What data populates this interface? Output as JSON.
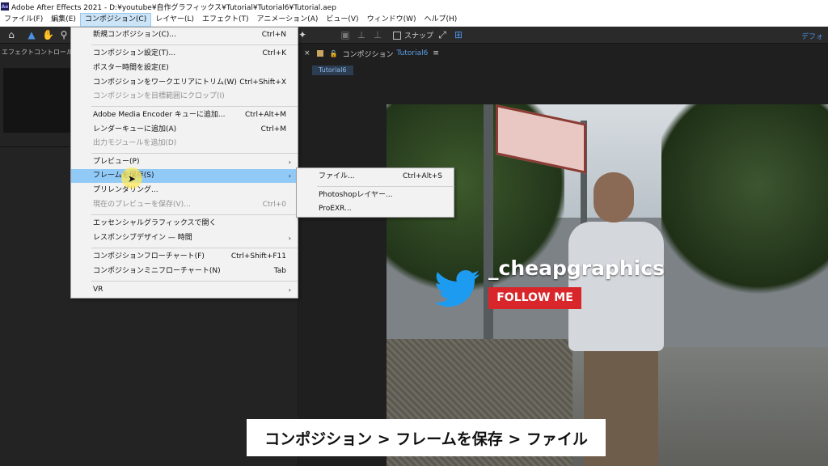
{
  "window": {
    "app_icon": "Ae",
    "title": "Adobe After Effects 2021 - D:¥youtube¥自作グラフィックス¥Tutorial¥Tutorial6¥Tutorial.aep"
  },
  "menubar": {
    "items": [
      "ファイル(F)",
      "編集(E)",
      "コンポジション(C)",
      "レイヤー(L)",
      "エフェクト(T)",
      "アニメーション(A)",
      "ビュー(V)",
      "ウィンドウ(W)",
      "ヘルプ(H)"
    ],
    "active_index": 2
  },
  "toolbar": {
    "snap_label": "スナップ",
    "workspace": "デフォ"
  },
  "left_panel": {
    "tab_label": "エフェクトコントロール s"
  },
  "comp_panel": {
    "tab_prefix": "コンポジション",
    "comp_name": "Tutorial6",
    "sub_tab": "Tutorial6"
  },
  "composition_menu": {
    "items": [
      {
        "label": "新規コンポジション(C)...",
        "shortcut": "Ctrl+N"
      },
      {
        "label": "コンポジション設定(T)...",
        "shortcut": "Ctrl+K"
      },
      {
        "label": "ポスター時間を設定(E)",
        "shortcut": ""
      },
      {
        "label": "コンポジションをワークエリアにトリム(W)",
        "shortcut": "Ctrl+Shift+X"
      },
      {
        "label": "コンポジションを目標範囲にクロップ(I)",
        "shortcut": "",
        "disabled": true
      },
      {
        "label": "Adobe Media Encoder キューに追加...",
        "shortcut": "Ctrl+Alt+M"
      },
      {
        "label": "レンダーキューに追加(A)",
        "shortcut": "Ctrl+M"
      },
      {
        "label": "出力モジュールを追加(D)",
        "shortcut": "",
        "disabled": true
      },
      {
        "label": "プレビュー(P)",
        "shortcut": "",
        "submenu": true
      },
      {
        "label": "フレームを保存(S)",
        "shortcut": "",
        "submenu": true,
        "highlighted": true
      },
      {
        "label": "プリレンダリング...",
        "shortcut": ""
      },
      {
        "label": "現在のプレビューを保存(V)...",
        "shortcut": "Ctrl+0",
        "disabled": true
      },
      {
        "label": "エッセンシャルグラフィックスで開く",
        "shortcut": ""
      },
      {
        "label": "レスポンシブデザイン — 時間",
        "shortcut": "",
        "submenu": true
      },
      {
        "label": "コンポジションフローチャート(F)",
        "shortcut": "Ctrl+Shift+F11"
      },
      {
        "label": "コンポジションミニフローチャート(N)",
        "shortcut": "Tab"
      },
      {
        "label": "VR",
        "shortcut": "",
        "submenu": true
      }
    ]
  },
  "save_frame_submenu": {
    "items": [
      {
        "label": "ファイル...",
        "shortcut": "Ctrl+Alt+S"
      },
      {
        "label": "Photoshopレイヤー...",
        "shortcut": ""
      },
      {
        "label": "ProEXR...",
        "shortcut": ""
      }
    ]
  },
  "overlay": {
    "handle": "_cheapgraphics",
    "follow_label": "FOLLOW ME"
  },
  "caption": {
    "text": "コンポジション > フレームを保存 > ファイル"
  },
  "colors": {
    "menu_highlight": "#91c9f7",
    "follow_red": "#d8262a",
    "twitter_blue": "#1d9bf0"
  }
}
